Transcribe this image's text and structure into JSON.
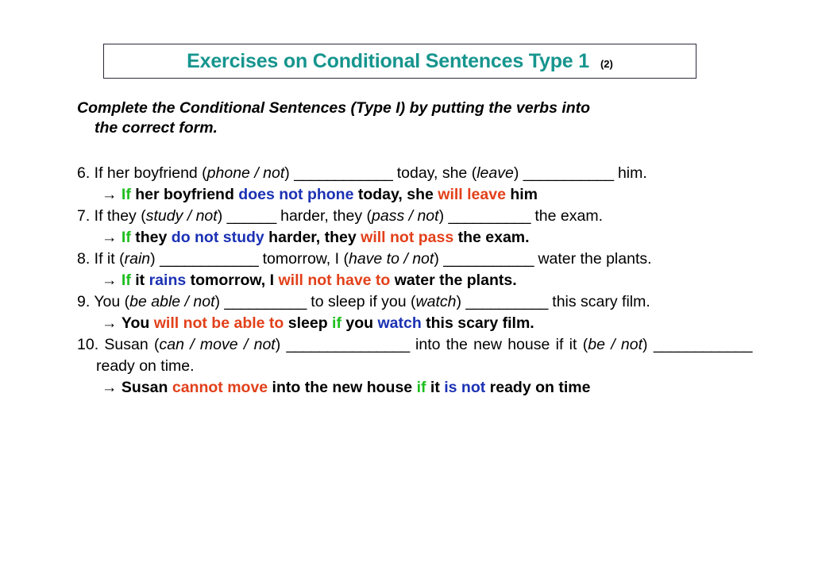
{
  "title": {
    "main": "Exercises on Conditional Sentences Type 1",
    "superscript": "(2)"
  },
  "instruction": {
    "line1": "Complete the Conditional Sentences (Type I) by putting the verbs into",
    "line2": "the correct form."
  },
  "colors": {
    "title_teal": "#16958e",
    "green": "#1fbf1f",
    "blue": "#1b31b4",
    "red": "#e2401a",
    "border": "#2b2b3c"
  },
  "arrow_glyph": "→",
  "exercises": [
    {
      "number": "6.",
      "question": {
        "p1": " If her boyfriend (",
        "verb1": "phone / not",
        "p2": ") ",
        "blank1": "____________",
        "p3": " today, she (",
        "verb2": "leave",
        "p4": ") ",
        "blank2": "___________",
        "p5": " him."
      },
      "answer": {
        "arrow": "→ ",
        "w1": "If",
        "w2": " her boyfriend ",
        "w3": "does not phone",
        "w4": " today, she ",
        "w5": "will leave",
        "w6": " him"
      }
    },
    {
      "number": "7.",
      "question": {
        "p1": " If they (",
        "verb1": "study / not",
        "p2": ") ",
        "blank1": "______",
        "p3": "  harder, they (",
        "verb2": "pass / not",
        "p4": ") ",
        "blank2": "__________",
        "p5": " the exam."
      },
      "answer": {
        "arrow": "→ ",
        "w1": "If",
        "w2": " they ",
        "w3": "do not study",
        "w4": " harder, they ",
        "w5": "will not pass",
        "w6": " the exam."
      }
    },
    {
      "number": "8.",
      "question": {
        "p1": " If it (",
        "verb1": "rain",
        "p2": ") ",
        "blank1": "____________",
        "p3": " tomorrow, I (",
        "verb2": "have to / not",
        "p4": ") ",
        "blank2": "___________",
        "p5": "  water the plants."
      },
      "answer": {
        "arrow": "→ ",
        "w1": "If",
        "w2": " it ",
        "w3": "rains",
        "w4": " tomorrow, I ",
        "w5": "will not have to",
        "w6": " water the plants."
      }
    },
    {
      "number": "9.",
      "question": {
        "p1": " You (",
        "verb1": "be able / not",
        "p2": ") ",
        "blank1": "__________",
        "p3": "  to sleep if you (",
        "verb2": "watch",
        "p4": ") ",
        "blank2": "__________",
        "p5": "  this scary film."
      },
      "answer": {
        "arrow": "→ ",
        "w1": "You ",
        "w2": "will not be able to",
        "w3": " sleep ",
        "w4": "if",
        "w5": " you ",
        "w6": "watch",
        "w7": " this scary film."
      }
    },
    {
      "number": "10.",
      "question": {
        "p1": " Susan (",
        "verb1": "can / move / not",
        "p2": ") ",
        "blank1": "_______________",
        "p3": "  into the new house if it (",
        "verb2": "be / not",
        "p4": ") ",
        "blank2": "____________",
        "p5": " ready on time."
      },
      "answer": {
        "arrow": "→ ",
        "w1": "Susan ",
        "w2": "cannot move",
        "w3": " into the new house ",
        "w4": "if",
        "w5": " it ",
        "w6": "is not",
        "w7": " ready on time"
      }
    }
  ]
}
